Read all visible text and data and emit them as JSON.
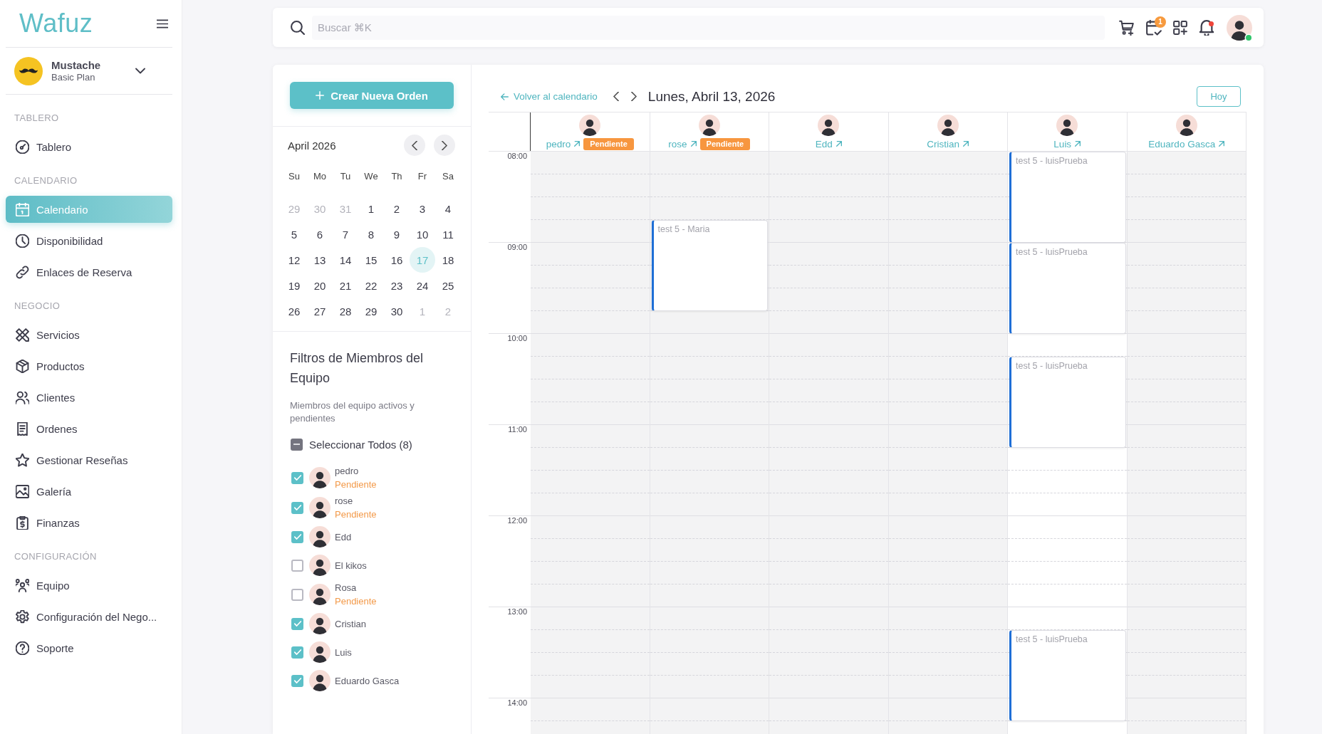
{
  "sidebar": {
    "logo": "Wafuz",
    "account": {
      "name": "Mustache",
      "plan": "Basic Plan"
    },
    "sections": [
      {
        "label": "TABLERO",
        "items": [
          {
            "label": "Tablero",
            "selected": false
          }
        ]
      },
      {
        "label": "CALENDARIO",
        "items": [
          {
            "label": "Calendario",
            "selected": true
          },
          {
            "label": "Disponibilidad",
            "selected": false
          },
          {
            "label": "Enlaces de Reserva",
            "selected": false
          }
        ]
      },
      {
        "label": "NEGOCIO",
        "items": [
          {
            "label": "Servicios",
            "selected": false
          },
          {
            "label": "Productos",
            "selected": false
          },
          {
            "label": "Clientes",
            "selected": false
          },
          {
            "label": "Ordenes",
            "selected": false
          },
          {
            "label": "Gestionar Reseñas",
            "selected": false
          },
          {
            "label": "Galería",
            "selected": false
          },
          {
            "label": "Finanzas",
            "selected": false
          }
        ]
      },
      {
        "label": "CONFIGURACIÓN",
        "items": [
          {
            "label": "Equipo",
            "selected": false
          },
          {
            "label": "Configuración del Nego...",
            "selected": false
          },
          {
            "label": "Soporte",
            "selected": false
          }
        ]
      }
    ]
  },
  "topbar": {
    "search": {
      "placeholder": "Buscar ⌘K"
    },
    "tasks_badge": "1",
    "notification_alert": true,
    "user_online": true
  },
  "create_button": "Crear Nueva Orden",
  "mini_calendar": {
    "month": "April 2026",
    "weekdays": [
      "Su",
      "Mo",
      "Tu",
      "We",
      "Th",
      "Fr",
      "Sa"
    ],
    "days": [
      {
        "label": "29",
        "outside_month": true,
        "selected": false
      },
      {
        "label": "30",
        "outside_month": true,
        "selected": false
      },
      {
        "label": "31",
        "outside_month": true,
        "selected": false
      },
      {
        "label": "1",
        "outside_month": false,
        "selected": false
      },
      {
        "label": "2",
        "outside_month": false,
        "selected": false
      },
      {
        "label": "3",
        "outside_month": false,
        "selected": false
      },
      {
        "label": "4",
        "outside_month": false,
        "selected": false
      },
      {
        "label": "5",
        "outside_month": false,
        "selected": false
      },
      {
        "label": "6",
        "outside_month": false,
        "selected": false
      },
      {
        "label": "7",
        "outside_month": false,
        "selected": false
      },
      {
        "label": "8",
        "outside_month": false,
        "selected": false
      },
      {
        "label": "9",
        "outside_month": false,
        "selected": false
      },
      {
        "label": "10",
        "outside_month": false,
        "selected": false
      },
      {
        "label": "11",
        "outside_month": false,
        "selected": false
      },
      {
        "label": "12",
        "outside_month": false,
        "selected": false
      },
      {
        "label": "13",
        "outside_month": false,
        "selected": false
      },
      {
        "label": "14",
        "outside_month": false,
        "selected": false
      },
      {
        "label": "15",
        "outside_month": false,
        "selected": false
      },
      {
        "label": "16",
        "outside_month": false,
        "selected": false
      },
      {
        "label": "17",
        "outside_month": false,
        "selected": true
      },
      {
        "label": "18",
        "outside_month": false,
        "selected": false
      },
      {
        "label": "19",
        "outside_month": false,
        "selected": false
      },
      {
        "label": "20",
        "outside_month": false,
        "selected": false
      },
      {
        "label": "21",
        "outside_month": false,
        "selected": false
      },
      {
        "label": "22",
        "outside_month": false,
        "selected": false
      },
      {
        "label": "23",
        "outside_month": false,
        "selected": false
      },
      {
        "label": "24",
        "outside_month": false,
        "selected": false
      },
      {
        "label": "25",
        "outside_month": false,
        "selected": false
      },
      {
        "label": "26",
        "outside_month": false,
        "selected": false
      },
      {
        "label": "27",
        "outside_month": false,
        "selected": false
      },
      {
        "label": "28",
        "outside_month": false,
        "selected": false
      },
      {
        "label": "29",
        "outside_month": false,
        "selected": false
      },
      {
        "label": "30",
        "outside_month": false,
        "selected": false
      },
      {
        "label": "1",
        "outside_month": true,
        "selected": false
      },
      {
        "label": "2",
        "outside_month": true,
        "selected": false
      }
    ]
  },
  "team_filters": {
    "title": "Filtros de Miembros del Equipo",
    "subtitle": "Miembros del equipo activos y pendientes",
    "select_all": {
      "label": "Seleccionar Todos (8)",
      "indeterminate": true
    },
    "members": [
      {
        "name": "pedro",
        "status": "Pendiente",
        "checked": true
      },
      {
        "name": "rose",
        "status": "Pendiente",
        "checked": true
      },
      {
        "name": "Edd",
        "checked": true
      },
      {
        "name": "El kikos",
        "checked": false
      },
      {
        "name": "Rosa",
        "status": "Pendiente",
        "checked": false
      },
      {
        "name": "Cristian",
        "checked": true
      },
      {
        "name": "Luis",
        "checked": true
      },
      {
        "name": "Eduardo Gasca",
        "checked": true
      }
    ]
  },
  "day_view": {
    "back_link": "Volver al calendario",
    "title": "Lunes, Abril 13, 2026",
    "today_button": "Hoy",
    "hours": [
      "08:00",
      "09:00",
      "10:00",
      "11:00",
      "12:00",
      "13:00",
      "14:00"
    ],
    "columns": [
      {
        "name": "pedro",
        "status": "Pendiente",
        "available": false
      },
      {
        "name": "rose",
        "status": "Pendiente",
        "available": false,
        "schedule": [
          {
            "kind": "gap"
          },
          {
            "kind": "gap"
          },
          {
            "kind": "gap"
          },
          {
            "kind": "event",
            "title": "test 5 - Maria"
          }
        ]
      },
      {
        "name": "Edd",
        "available": false
      },
      {
        "name": "Cristian",
        "available": false
      },
      {
        "name": "Luis",
        "available": true,
        "schedule": [
          {
            "kind": "event",
            "title": "test 5 - luisPrueba"
          },
          {
            "kind": "event",
            "title": "test 5 - luisPrueba"
          },
          {
            "kind": "gap"
          },
          {
            "kind": "event",
            "title": "test 5 - luisPrueba"
          },
          {
            "kind": "gap"
          },
          {
            "kind": "gap"
          },
          {
            "kind": "gap"
          },
          {
            "kind": "gap"
          },
          {
            "kind": "gap"
          },
          {
            "kind": "gap"
          },
          {
            "kind": "gap"
          },
          {
            "kind": "gap"
          },
          {
            "kind": "event",
            "title": "test 5 - luisPrueba"
          }
        ]
      },
      {
        "name": "Eduardo Gasca",
        "available": false
      }
    ]
  }
}
